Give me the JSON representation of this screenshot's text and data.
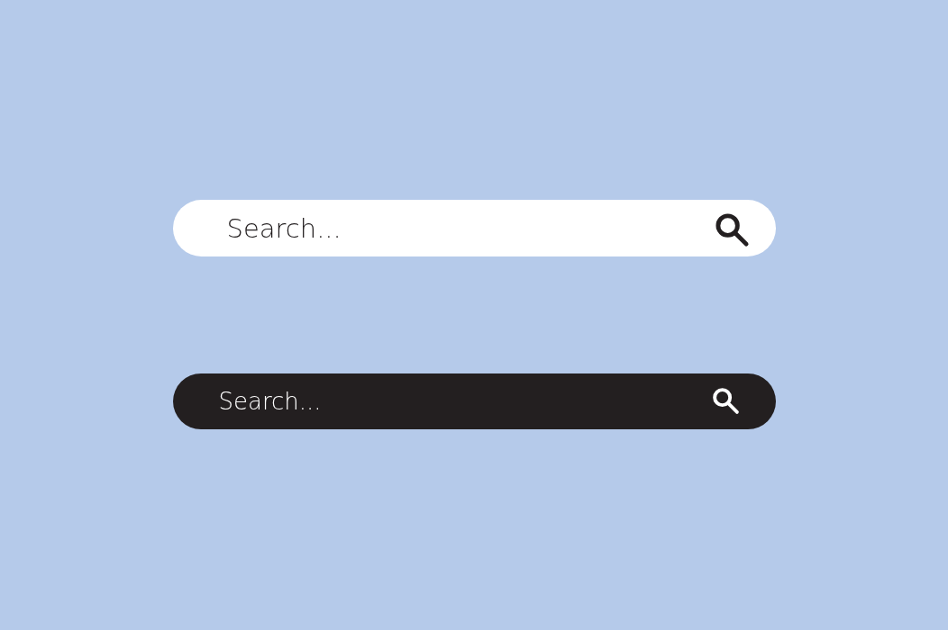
{
  "search_bars": [
    {
      "kind": "light",
      "placeholder": "Search..."
    },
    {
      "kind": "dark",
      "placeholder": "Search..."
    }
  ]
}
